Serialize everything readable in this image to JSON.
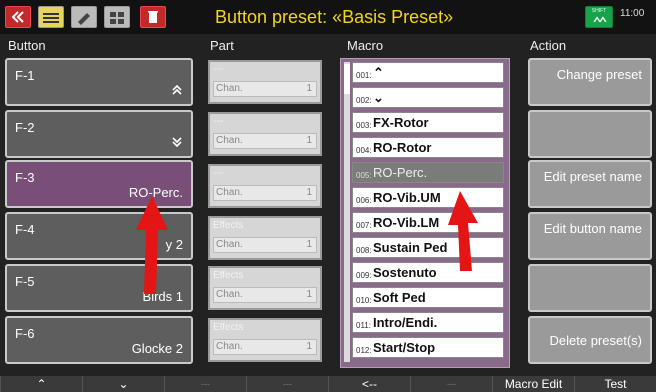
{
  "title": "Button preset: «Basis Preset»",
  "clock": "11:00",
  "shift_label": "SHIFT",
  "toolbar": {
    "menu_label": "MENU",
    "edit_label": "EDIT",
    "edit2_label": "EDIT"
  },
  "headers": {
    "button": "Button",
    "part": "Part",
    "macro": "Macro",
    "action": "Action"
  },
  "buttons": [
    {
      "name": "F-1",
      "value": ""
    },
    {
      "name": "F-2",
      "value": ""
    },
    {
      "name": "F-3",
      "value": "RO-Perc."
    },
    {
      "name": "F-4",
      "value": "y 2"
    },
    {
      "name": "F-5",
      "value": "Birds 1"
    },
    {
      "name": "F-6",
      "value": "Glocke 2"
    }
  ],
  "parts": [
    {
      "type": "---",
      "chan": "Chan.",
      "num": "1"
    },
    {
      "type": "---",
      "chan": "Chan.",
      "num": "1"
    },
    {
      "type": "---",
      "chan": "Chan.",
      "num": "1"
    },
    {
      "type": "Effects",
      "chan": "Chan.",
      "num": "1"
    },
    {
      "type": "Effects",
      "chan": "Chan.",
      "num": "1"
    },
    {
      "type": "Effects",
      "chan": "Chan.",
      "num": "1"
    }
  ],
  "macros": [
    {
      "num": "001:",
      "text": "⌃"
    },
    {
      "num": "002:",
      "text": "⌄"
    },
    {
      "num": "003:",
      "text": "FX-Rotor"
    },
    {
      "num": "004:",
      "text": "RO-Rotor"
    },
    {
      "num": "005:",
      "text": "RO-Perc."
    },
    {
      "num": "006:",
      "text": "RO-Vib.UM"
    },
    {
      "num": "007:",
      "text": "RO-Vib.LM"
    },
    {
      "num": "008:",
      "text": "Sustain Ped"
    },
    {
      "num": "009:",
      "text": "Sostenuto"
    },
    {
      "num": "010:",
      "text": "Soft Ped"
    },
    {
      "num": "011:",
      "text": "Intro/Endi."
    },
    {
      "num": "012:",
      "text": "Start/Stop"
    }
  ],
  "actions": [
    "Change preset",
    "",
    "Edit preset name",
    "Edit button name",
    "",
    "Delete preset(s)"
  ],
  "bottom": [
    "⌃",
    "⌄",
    "---",
    "---",
    "<--",
    "---",
    "Macro Edit",
    "Test"
  ]
}
